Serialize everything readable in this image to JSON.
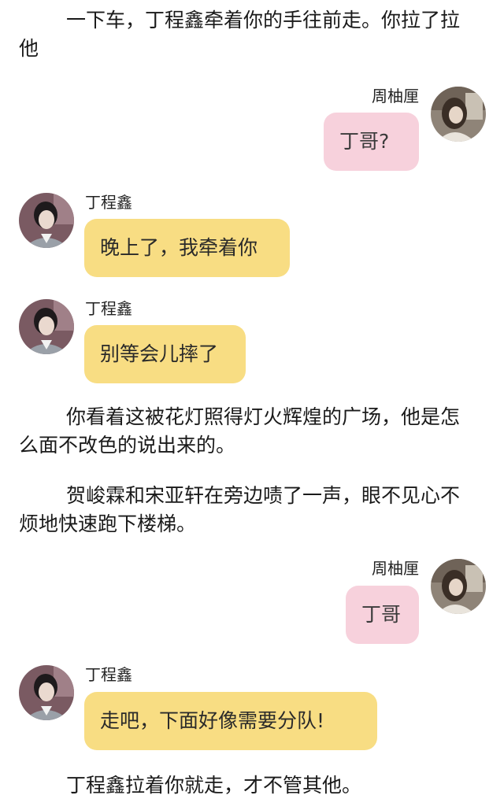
{
  "paragraphs": [
    "一下车，丁程鑫牵着你的手往前走。你拉了拉他",
    "你看着这被花灯照得灯火辉煌的广场，他是怎么面不改色的说出来的。",
    "贺峻霖和宋亚轩在旁边啧了一声，眼不见心不烦地快速跑下楼梯。",
    "丁程鑫拉着你就走，才不管其他。"
  ],
  "messages": [
    {
      "sender": "周柚厘",
      "text": "丁哥?"
    },
    {
      "sender": "丁程鑫",
      "text": "晚上了，我牵着你"
    },
    {
      "sender": "丁程鑫",
      "text": "别等会儿摔了"
    },
    {
      "sender": "周柚厘",
      "text": "丁哥"
    },
    {
      "sender": "丁程鑫",
      "text": "走吧，下面好像需要分队!"
    }
  ],
  "colors": {
    "left_bubble": "#f8dd83",
    "right_bubble": "#f7d1dc",
    "background": "#ffffff"
  },
  "avatars": {
    "right": "avatar-girl-photo",
    "left": "avatar-boy-photo"
  }
}
